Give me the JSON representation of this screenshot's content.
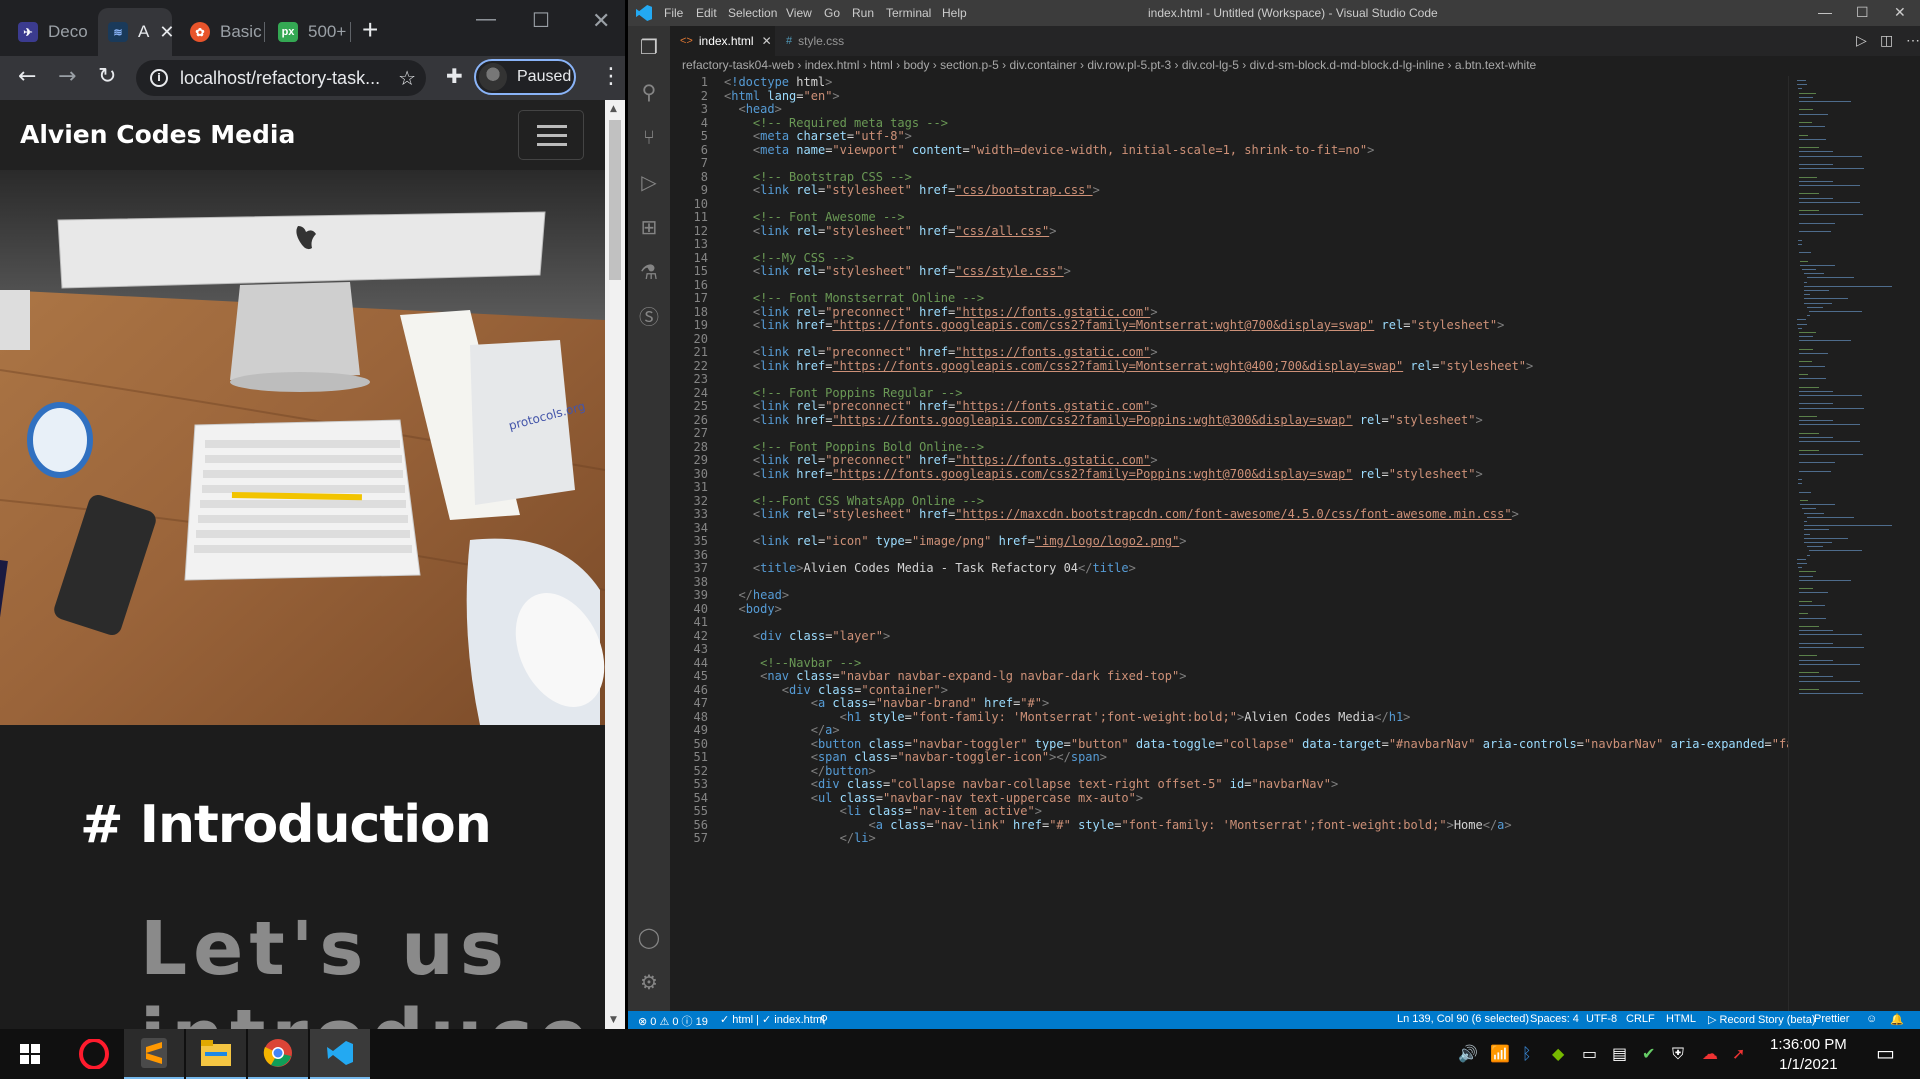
{
  "browser": {
    "tabs": [
      {
        "title": "Deco",
        "active": false
      },
      {
        "title": "A",
        "active": true
      },
      {
        "title": "Basic",
        "active": false
      },
      {
        "title": "500+",
        "active": false
      }
    ],
    "url": "localhost/refactory-task...",
    "profile_status": "Paused",
    "page": {
      "brand": "Alvien Codes Media",
      "intro_heading": "# Introduction",
      "intro_text": "Let's us introduce"
    }
  },
  "vscode": {
    "menu": [
      "File",
      "Edit",
      "Selection",
      "View",
      "Go",
      "Run",
      "Terminal",
      "Help"
    ],
    "window_title": "index.html - Untitled (Workspace) - Visual Studio Code",
    "tabs": [
      {
        "label": "index.html",
        "active": true
      },
      {
        "label": "style.css",
        "active": false
      }
    ],
    "breadcrumb": [
      "refactory-task04-web",
      "index.html",
      "html",
      "body",
      "section.p-5",
      "div.container",
      "div.row.pl-5.pt-3",
      "div.col-lg-5",
      "div.d-sm-block.d-md-block.d-lg-inline",
      "a.btn.text-white"
    ],
    "code_lines": [
      "<!doctype html>",
      "<html lang=\"en\">",
      "  <head>",
      "    <!-- Required meta tags -->",
      "    <meta charset=\"utf-8\">",
      "    <meta name=\"viewport\" content=\"width=device-width, initial-scale=1, shrink-to-fit=no\">",
      "",
      "    <!-- Bootstrap CSS -->",
      "    <link rel=\"stylesheet\" href=\"css/bootstrap.css\">",
      "",
      "    <!-- Font Awesome -->",
      "    <link rel=\"stylesheet\" href=\"css/all.css\">",
      "",
      "    <!--My CSS -->",
      "    <link rel=\"stylesheet\" href=\"css/style.css\">",
      "",
      "    <!-- Font Monstserrat Online -->",
      "    <link rel=\"preconnect\" href=\"https://fonts.gstatic.com\">",
      "    <link href=\"https://fonts.googleapis.com/css2?family=Montserrat:wght@700&display=swap\" rel=\"stylesheet\">",
      "",
      "    <link rel=\"preconnect\" href=\"https://fonts.gstatic.com\">",
      "    <link href=\"https://fonts.googleapis.com/css2?family=Montserrat:wght@400;700&display=swap\" rel=\"stylesheet\">",
      "",
      "    <!-- Font Poppins Regular -->",
      "    <link rel=\"preconnect\" href=\"https://fonts.gstatic.com\">",
      "    <link href=\"https://fonts.googleapis.com/css2?family=Poppins:wght@300&display=swap\" rel=\"stylesheet\">",
      "",
      "    <!-- Font Poppins Bold Online-->",
      "    <link rel=\"preconnect\" href=\"https://fonts.gstatic.com\">",
      "    <link href=\"https://fonts.googleapis.com/css2?family=Poppins:wght@700&display=swap\" rel=\"stylesheet\">",
      "",
      "    <!--Font CSS WhatsApp Online -->",
      "    <link rel=\"stylesheet\" href=\"https://maxcdn.bootstrapcdn.com/font-awesome/4.5.0/css/font-awesome.min.css\">",
      "",
      "    <link rel=\"icon\" type=\"image/png\" href=\"img/logo/logo2.png\">",
      "",
      "    <title>Alvien Codes Media - Task Refactory 04</title>",
      "",
      "  </head>",
      "  <body>",
      "",
      "    <div class=\"layer\">",
      "",
      "     <!--Navbar -->",
      "     <nav class=\"navbar navbar-expand-lg navbar-dark fixed-top\">",
      "        <div class=\"container\">",
      "            <a class=\"navbar-brand\" href=\"#\">",
      "                <h1 style=\"font-family: 'Montserrat';font-weight:bold;\">Alvien Codes Media</h1>",
      "            </a>",
      "            <button class=\"navbar-toggler\" type=\"button\" data-toggle=\"collapse\" data-target=\"#navbarNav\" aria-controls=\"navbarNav\" aria-expanded=\"false\" aria-l",
      "            <span class=\"navbar-toggler-icon\"></span>",
      "            </button>",
      "            <div class=\"collapse navbar-collapse text-right offset-5\" id=\"navbarNav\">",
      "            <ul class=\"navbar-nav text-uppercase mx-auto\">",
      "                <li class=\"nav-item active\">",
      "                    <a class=\"nav-link\" href=\"#\" style=\"font-family: 'Montserrat';font-weight:bold;\">Home</a>",
      "                </li>"
    ],
    "status": {
      "problems": "⊗ 0 ⚠ 0 ⓘ 19",
      "html_check": "✓ html | ✓ index.html",
      "position": "Ln 139, Col 90 (6 selected)",
      "spaces": "Spaces: 4",
      "encoding": "UTF-8",
      "eol": "CRLF",
      "language": "HTML",
      "record": "▷ Record Story (beta)",
      "formatter": "Prettier"
    }
  },
  "taskbar": {
    "time": "1:36:00 PM",
    "date": "1/1/2021"
  },
  "colors": {
    "vscode_status": "#007acc",
    "chrome_dark": "#202124",
    "accent_paused": "#8ab4f8"
  }
}
